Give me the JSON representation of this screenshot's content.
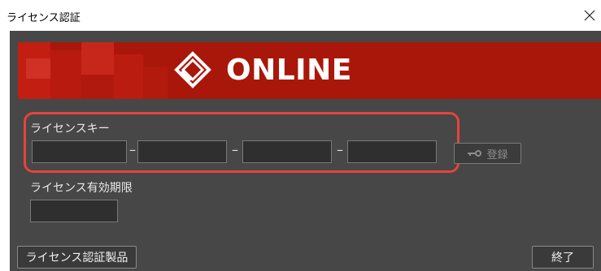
{
  "window": {
    "title": "ライセンス認証",
    "close_glyph": "✕"
  },
  "banner": {
    "logo_icon": "cube-logo-icon",
    "text": "ONLINE",
    "color": "#a9170b"
  },
  "license_key": {
    "label": "ライセンスキー",
    "fields": [
      "",
      "",
      "",
      ""
    ],
    "separator": "–",
    "register_label": "登録",
    "register_icon": "key-icon",
    "highlight_color": "#e5433d"
  },
  "expiry": {
    "label": "ライセンス有効期限",
    "value": ""
  },
  "footer": {
    "products_label": "ライセンス認証製品",
    "exit_label": "終了"
  }
}
